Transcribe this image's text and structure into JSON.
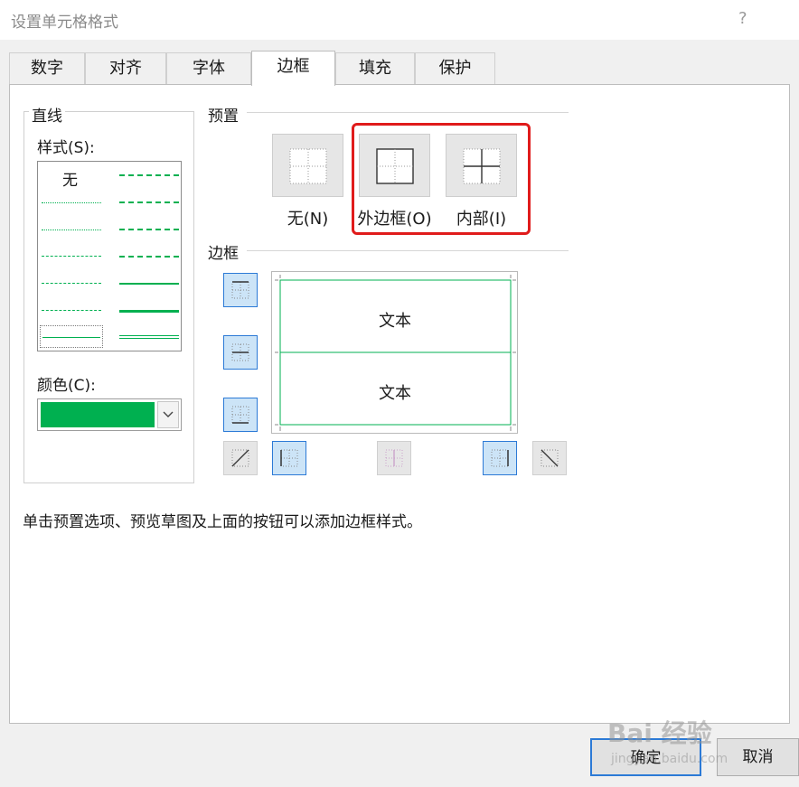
{
  "dialog": {
    "title": "设置单元格格式",
    "help_label": "?"
  },
  "tabs": [
    {
      "label": "数字",
      "active": false
    },
    {
      "label": "对齐",
      "active": false
    },
    {
      "label": "字体",
      "active": false
    },
    {
      "label": "边框",
      "active": true
    },
    {
      "label": "填充",
      "active": false
    },
    {
      "label": "保护",
      "active": false
    }
  ],
  "line": {
    "group_title": "直线",
    "style_label": "样式(S):",
    "none_label": "无",
    "color_label": "颜色(C):",
    "color_value": "#00b050"
  },
  "presets": {
    "group_title": "预置",
    "items": [
      {
        "label": "无(N)",
        "icon": "preset-none-icon"
      },
      {
        "label": "外边框(O)",
        "icon": "preset-outline-icon"
      },
      {
        "label": "内部(I)",
        "icon": "preset-inside-icon"
      }
    ],
    "highlight_color": "#e01b1b"
  },
  "border": {
    "group_title": "边框",
    "preview_text_top": "文本",
    "preview_text_bottom": "文本",
    "line_color": "#00b050",
    "accent": "#2c7ad6"
  },
  "hint": "单击预置选项、预览草图及上面的按钮可以添加边框样式。",
  "buttons": {
    "ok": "确定",
    "cancel": "取消"
  },
  "watermark": {
    "text": "Bai 经验",
    "sub": "jingyan.baidu.com"
  }
}
